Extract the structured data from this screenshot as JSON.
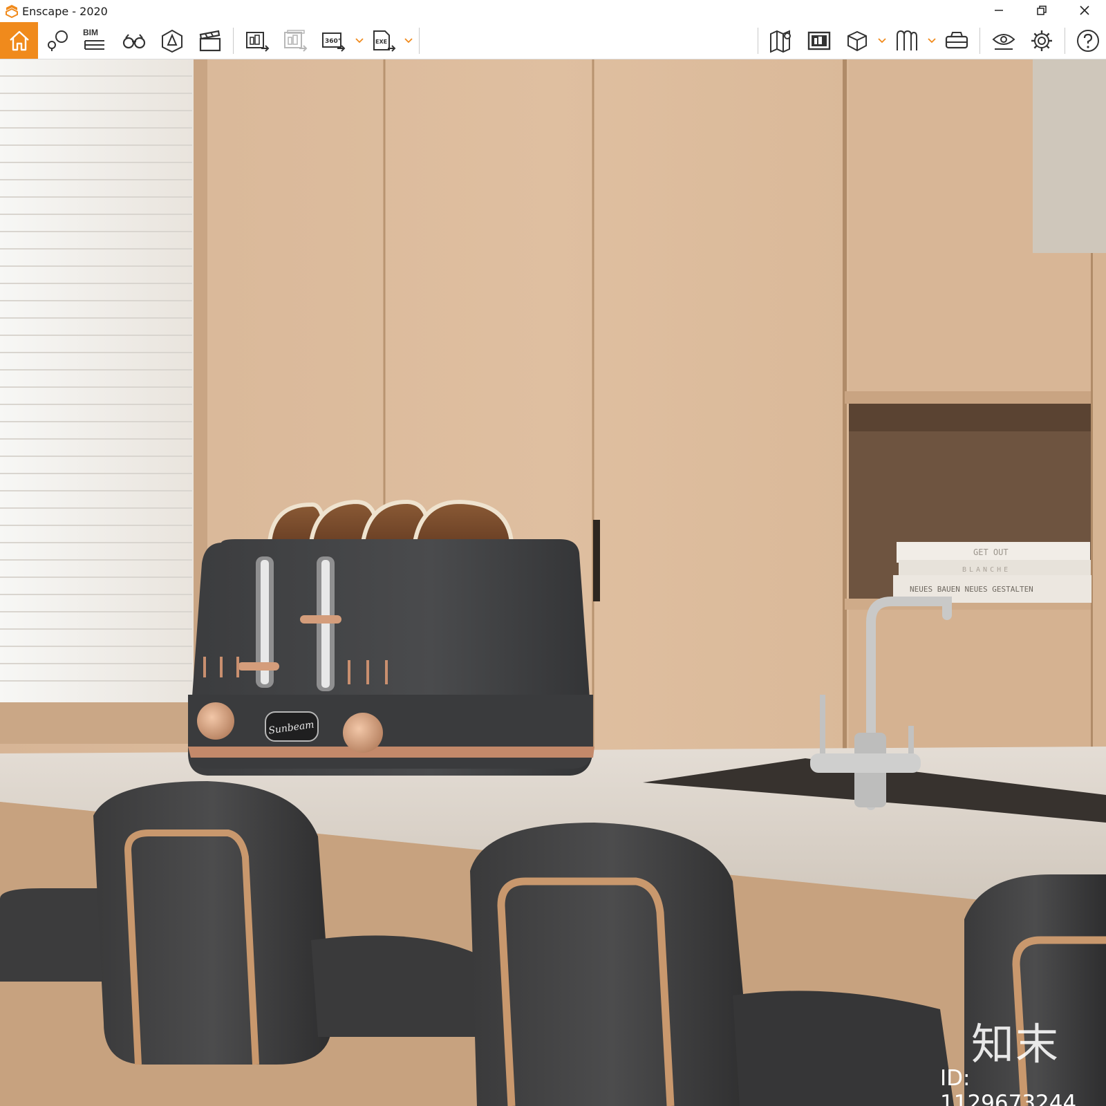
{
  "window": {
    "title": "Enscape - 2020",
    "controls": [
      "minimize-icon",
      "restore-icon",
      "close-icon"
    ]
  },
  "toolbar": {
    "accent_color": "#f08a1c",
    "bim_label": "BIM",
    "left_tools": [
      "home-icon",
      "views-icon",
      "bim-icon",
      "binoculars-icon",
      "asset-library-icon",
      "video-editor-icon",
      "screenshot-icon",
      "batch-render-icon",
      "panorama-360-icon",
      "export-exe-icon"
    ],
    "right_tools": [
      "map-icon",
      "atlas-icon",
      "cube-icon",
      "archive-icon",
      "vr-headset-icon",
      "visual-settings-icon",
      "settings-gear-icon",
      "help-icon"
    ]
  },
  "scene": {
    "toaster_brand": "Sunbeam",
    "books": [
      "GET OUT",
      "BLANCHE",
      "NEUES BAUEN NEUES GESTALTEN"
    ]
  },
  "watermark": {
    "logo": "知末",
    "id_text": "ID: 1129673244"
  }
}
